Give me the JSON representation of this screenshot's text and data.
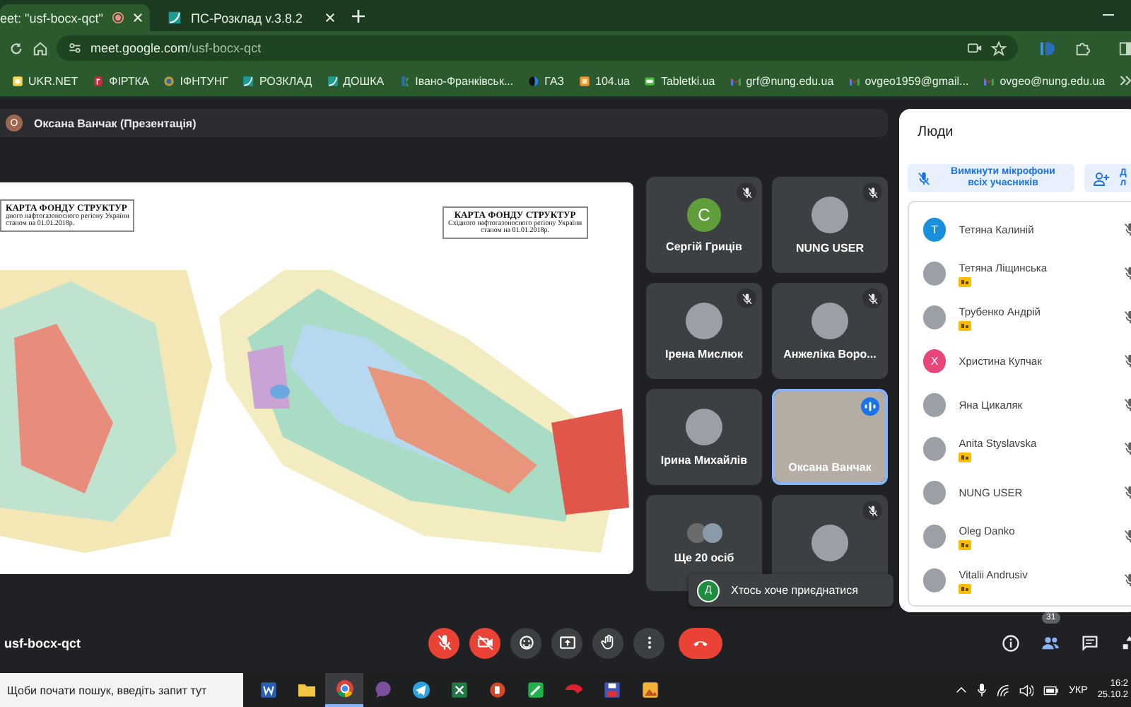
{
  "browser": {
    "tabs": [
      {
        "title": "eet: \"usf-bocx-qct\"",
        "kind": "recording",
        "selected": true
      },
      {
        "title": "ПС-Розклад v.3.8.2",
        "kind": "page",
        "selected": false
      }
    ],
    "url_host": "meet.google.com",
    "url_path": "/usf-bocx-qct",
    "bookmarks": [
      {
        "label": "UKR.NET",
        "kind": "yellow"
      },
      {
        "label": "ФІРТКА",
        "kind": "red"
      },
      {
        "label": "ІФНТУНГ",
        "kind": "emblem"
      },
      {
        "label": "РОЗКЛАД",
        "kind": "teal"
      },
      {
        "label": "ДОШКА",
        "kind": "teal"
      },
      {
        "label": "Івано-Франківськ...",
        "kind": "city"
      },
      {
        "label": "ГАЗ",
        "kind": "gas"
      },
      {
        "label": "104.ua",
        "kind": "orange"
      },
      {
        "label": "Tabletki.ua",
        "kind": "green"
      },
      {
        "label": "grf@nung.edu.ua",
        "kind": "mail"
      },
      {
        "label": "ovgeo1959@gmail...",
        "kind": "mail"
      },
      {
        "label": "ovgeo@nung.edu.ua",
        "kind": "mail"
      }
    ]
  },
  "meet": {
    "presenter": {
      "initial": "О",
      "color": "#a0674f",
      "label": "Оксана Ванчак (Презентація)"
    },
    "slide": {
      "boxes": [
        {
          "title": "КАРТА ФОНДУ СТРУКТУР",
          "subtitle": "дного нафтогазоносного регіону України",
          "date": "станом на 01.01.2018р."
        },
        {
          "title": "КАРТА ФОНДУ СТРУКТУР",
          "subtitle": "Східного нафтогазоносного регіону України",
          "date": "станом на 01.01.2018р."
        }
      ]
    },
    "tiles": [
      {
        "name": "Сергій Гриців",
        "kind": "letter",
        "initial": "С",
        "color": "#5f9e3a",
        "muted": true,
        "speaking": false
      },
      {
        "name": "NUNG USER",
        "kind": "photo",
        "muted": true,
        "speaking": false
      },
      {
        "name": "Ірена Мислюк",
        "kind": "photo",
        "muted": true,
        "speaking": false
      },
      {
        "name": "Анжеліка Воро...",
        "kind": "photo",
        "muted": true,
        "speaking": false
      },
      {
        "name": "Ірина Михайлів",
        "kind": "photo",
        "muted": false,
        "speaking": false
      },
      {
        "name": "Оксана Ванчак",
        "kind": "video",
        "muted": false,
        "speaking": true
      },
      {
        "name": "Ще 20 осіб",
        "kind": "group",
        "muted": false,
        "speaking": false
      },
      {
        "kind": "photo",
        "muted": true,
        "speaking": false
      }
    ],
    "toast": {
      "initial": "Д",
      "color": "#1e8e3e",
      "text": "Хтось хоче приєднатися"
    },
    "people": {
      "title": "Люди",
      "mute_all": "Вимкнути мікрофони всіх учасників",
      "add": "Д л",
      "participants": [
        {
          "name": "Тетяна Калиній",
          "kind": "letter",
          "initial": "Т",
          "color": "#1a8fdc",
          "host": false
        },
        {
          "name": "Тетяна Ліщинська",
          "kind": "photo",
          "host": true
        },
        {
          "name": "Трубенко Андрій",
          "kind": "photo",
          "host": true
        },
        {
          "name": "Христина Купчак",
          "kind": "letter",
          "initial": "Х",
          "color": "#e8457a",
          "host": false
        },
        {
          "name": "Яна Цикаляк",
          "kind": "photo",
          "host": false
        },
        {
          "name": "Anita Styslavska",
          "kind": "photo",
          "host": true
        },
        {
          "name": "NUNG USER",
          "kind": "photo",
          "host": false
        },
        {
          "name": "Oleg Danko",
          "kind": "photo",
          "host": true
        },
        {
          "name": "Vitalii Andrusiv",
          "kind": "photo",
          "host": true
        }
      ]
    },
    "meeting_code": "usf-bocx-qct",
    "controls": [
      {
        "kind": "mic",
        "off": true
      },
      {
        "kind": "camera",
        "off": true
      },
      {
        "kind": "emoji",
        "off": false
      },
      {
        "kind": "present",
        "off": false
      },
      {
        "kind": "hand",
        "off": false
      },
      {
        "kind": "more",
        "off": false
      },
      {
        "kind": "end"
      }
    ],
    "side_controls": [
      {
        "kind": "info",
        "selected": false
      },
      {
        "kind": "people",
        "badge": "31",
        "selected": true
      },
      {
        "kind": "chat",
        "selected": false
      },
      {
        "kind": "activities",
        "selected": false
      }
    ]
  },
  "taskbar": {
    "search_placeholder": "Щоби почати пошук, введіть запит тут",
    "apps": [
      {
        "kind": "word",
        "selected": false
      },
      {
        "kind": "folder",
        "selected": false
      },
      {
        "kind": "chrome",
        "selected": true
      },
      {
        "kind": "viber",
        "selected": false
      },
      {
        "kind": "telegram",
        "selected": false
      },
      {
        "kind": "excel",
        "selected": false
      },
      {
        "kind": "powerpoint",
        "selected": false
      },
      {
        "kind": "pen",
        "selected": false
      },
      {
        "kind": "antivirus",
        "selected": false
      },
      {
        "kind": "save",
        "selected": false
      },
      {
        "kind": "photos",
        "selected": false
      }
    ],
    "language": "УКР",
    "time": "16:2",
    "date": "25.10.2"
  }
}
